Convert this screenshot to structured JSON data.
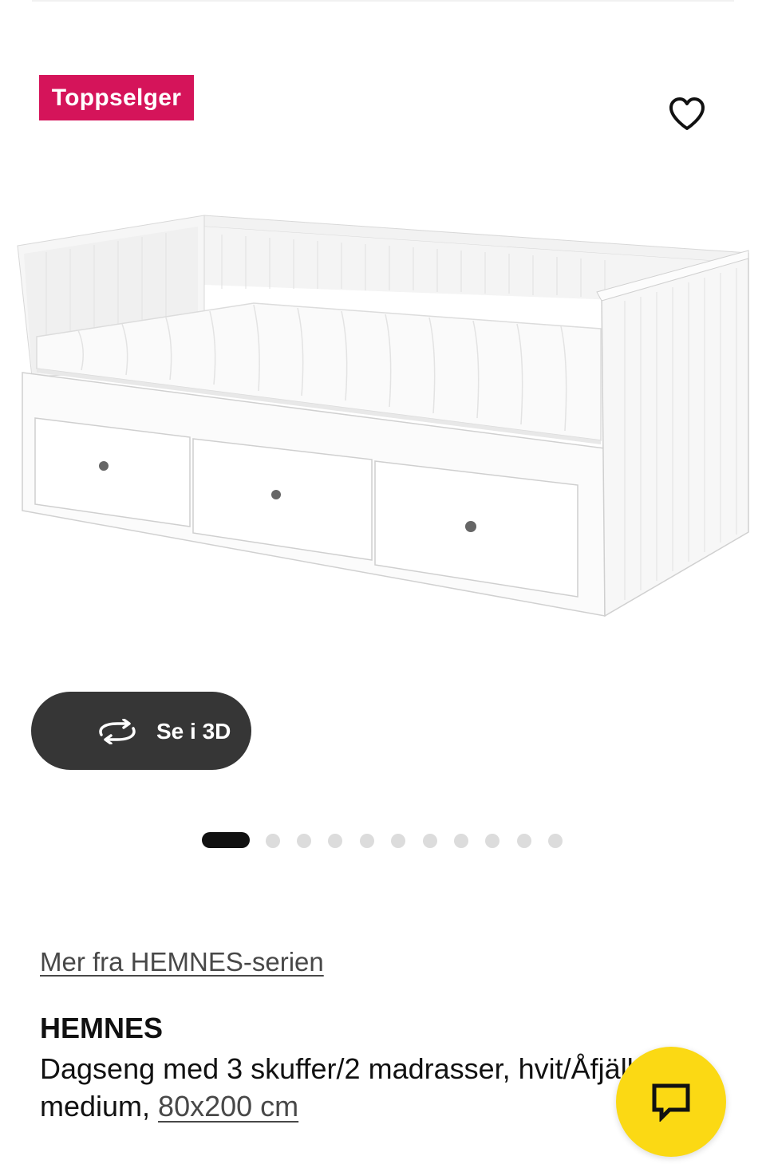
{
  "badge": {
    "label": "Toppselger",
    "color": "#d5145a"
  },
  "favorite": {
    "icon": "heart-icon"
  },
  "image": {
    "alt": "HEMNES Dagseng med 3 skuffer/2 madrasser"
  },
  "view_3d": {
    "label": "Se i 3D",
    "icon": "rotate-3d-icon"
  },
  "carousel": {
    "total": 12,
    "active_index": 0
  },
  "series_link": {
    "label": "Mer fra HEMNES-serien"
  },
  "product": {
    "name": "HEMNES",
    "description": "Dagseng med 3 skuffer/2 madrasser, hvit/Åfjäll medium, ",
    "size": "80x200 cm"
  },
  "chat": {
    "icon": "chat-icon",
    "color": "#fbd914"
  }
}
